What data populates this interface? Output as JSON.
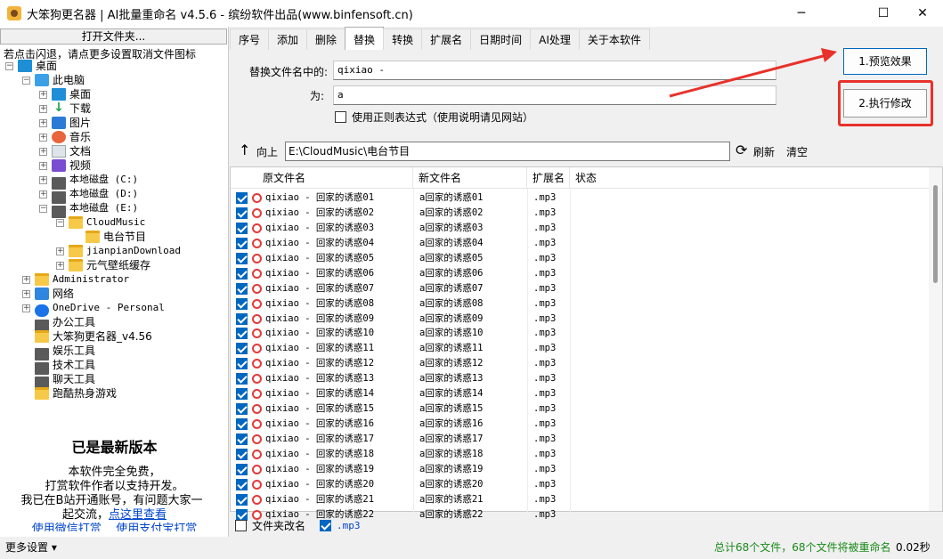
{
  "window": {
    "title": "大笨狗更名器 | AI批量重命名 v4.5.6 - 缤纷软件出品(www.binfensoft.cn)",
    "minimize": "─",
    "maximize": "☐",
    "close": "✕"
  },
  "left": {
    "open_button": "打开文件夹...",
    "hint": "若点击闪退，请点更多设置取消文件图标",
    "tree": [
      {
        "label": "桌面",
        "exp": "−",
        "icon": "desktop-icon",
        "mono": false
      },
      {
        "label": "此电脑",
        "exp": "−",
        "icon": "computer-icon",
        "mono": false
      },
      {
        "label": "桌面",
        "exp": "+",
        "icon": "desktop-icon",
        "mono": false
      },
      {
        "label": "下载",
        "exp": "+",
        "icon": "download-icon",
        "mono": false
      },
      {
        "label": "图片",
        "exp": "+",
        "icon": "pictures-icon",
        "mono": false
      },
      {
        "label": "音乐",
        "exp": "+",
        "icon": "music-icon",
        "mono": false
      },
      {
        "label": "文档",
        "exp": "+",
        "icon": "documents-icon",
        "mono": false
      },
      {
        "label": "视频",
        "exp": "+",
        "icon": "videos-icon",
        "mono": false
      },
      {
        "label": "本地磁盘 (C:)",
        "exp": "+",
        "icon": "drive-icon",
        "mono": true
      },
      {
        "label": "本地磁盘 (D:)",
        "exp": "+",
        "icon": "drive-icon",
        "mono": true
      },
      {
        "label": "本地磁盘 (E:)",
        "exp": "−",
        "icon": "drive-icon",
        "mono": true
      },
      {
        "label": "CloudMusic",
        "exp": "−",
        "icon": "folder-icon",
        "mono": true
      },
      {
        "label": "电台节目",
        "exp": "",
        "icon": "folder-icon",
        "mono": false
      },
      {
        "label": "jianpianDownload",
        "exp": "+",
        "icon": "folder-icon",
        "mono": true
      },
      {
        "label": "元气壁纸缓存",
        "exp": "+",
        "icon": "folder-icon",
        "mono": false
      },
      {
        "label": "Administrator",
        "exp": "+",
        "icon": "folder-icon",
        "mono": true
      },
      {
        "label": "网络",
        "exp": "+",
        "icon": "network-icon",
        "mono": false
      },
      {
        "label": "OneDrive - Personal",
        "exp": "+",
        "icon": "cloud-icon",
        "mono": true
      },
      {
        "label": "办公工具",
        "exp": "",
        "icon": "drive-icon",
        "mono": false
      },
      {
        "label": "大笨狗更名器_v4.56",
        "exp": "",
        "icon": "folder-icon",
        "mono": false
      },
      {
        "label": "娱乐工具",
        "exp": "",
        "icon": "drive-icon",
        "mono": false
      },
      {
        "label": "技术工具",
        "exp": "",
        "icon": "drive-icon",
        "mono": false
      },
      {
        "label": "聊天工具",
        "exp": "",
        "icon": "drive-icon",
        "mono": false
      },
      {
        "label": "跑酷热身游戏",
        "exp": "",
        "icon": "folder-icon",
        "mono": false
      }
    ],
    "version_title": "已是最新版本",
    "free_line1": "本软件完全免费，",
    "free_line2": "打赏软件作者以支持开发。",
    "bili_line": "我已在B站开通账号，有问题大家一",
    "bili_line2a": "起交流，",
    "bili_link": "点这里查看",
    "donate_line": "使用微信打赏    使用支付宝打赏",
    "more_settings": "更多设置 ▾"
  },
  "tabs": [
    "序号",
    "添加",
    "删除",
    "替换",
    "转换",
    "扩展名",
    "日期时间",
    "AI处理",
    "关于本软件"
  ],
  "replace": {
    "find_label": "替换文件名中的:",
    "find_value": "qixiao -",
    "with_label": "为:",
    "with_value": "a",
    "regex_label": "使用正则表达式（使用说明请见网站）"
  },
  "actions": {
    "preview": "1.预览效果",
    "execute": "2.执行修改"
  },
  "pathbar": {
    "up": "向上",
    "path": "E:\\CloudMusic\\电台节目",
    "refresh": "刷新",
    "clear": "清空"
  },
  "columns": [
    "原文件名",
    "新文件名",
    "扩展名",
    "状态"
  ],
  "files": [
    {
      "orig": "qixiao - 回家的诱惑01",
      "new": "a回家的诱惑01",
      "ext": ".mp3"
    },
    {
      "orig": "qixiao - 回家的诱惑02",
      "new": "a回家的诱惑02",
      "ext": ".mp3"
    },
    {
      "orig": "qixiao - 回家的诱惑03",
      "new": "a回家的诱惑03",
      "ext": ".mp3"
    },
    {
      "orig": "qixiao - 回家的诱惑04",
      "new": "a回家的诱惑04",
      "ext": ".mp3"
    },
    {
      "orig": "qixiao - 回家的诱惑05",
      "new": "a回家的诱惑05",
      "ext": ".mp3"
    },
    {
      "orig": "qixiao - 回家的诱惑06",
      "new": "a回家的诱惑06",
      "ext": ".mp3"
    },
    {
      "orig": "qixiao - 回家的诱惑07",
      "new": "a回家的诱惑07",
      "ext": ".mp3"
    },
    {
      "orig": "qixiao - 回家的诱惑08",
      "new": "a回家的诱惑08",
      "ext": ".mp3"
    },
    {
      "orig": "qixiao - 回家的诱惑09",
      "new": "a回家的诱惑09",
      "ext": ".mp3"
    },
    {
      "orig": "qixiao - 回家的诱惑10",
      "new": "a回家的诱惑10",
      "ext": ".mp3"
    },
    {
      "orig": "qixiao - 回家的诱惑11",
      "new": "a回家的诱惑11",
      "ext": ".mp3"
    },
    {
      "orig": "qixiao - 回家的诱惑12",
      "new": "a回家的诱惑12",
      "ext": ".mp3"
    },
    {
      "orig": "qixiao - 回家的诱惑13",
      "new": "a回家的诱惑13",
      "ext": ".mp3"
    },
    {
      "orig": "qixiao - 回家的诱惑14",
      "new": "a回家的诱惑14",
      "ext": ".mp3"
    },
    {
      "orig": "qixiao - 回家的诱惑15",
      "new": "a回家的诱惑15",
      "ext": ".mp3"
    },
    {
      "orig": "qixiao - 回家的诱惑16",
      "new": "a回家的诱惑16",
      "ext": ".mp3"
    },
    {
      "orig": "qixiao - 回家的诱惑17",
      "new": "a回家的诱惑17",
      "ext": ".mp3"
    },
    {
      "orig": "qixiao - 回家的诱惑18",
      "new": "a回家的诱惑18",
      "ext": ".mp3"
    },
    {
      "orig": "qixiao - 回家的诱惑19",
      "new": "a回家的诱惑19",
      "ext": ".mp3"
    },
    {
      "orig": "qixiao - 回家的诱惑20",
      "new": "a回家的诱惑20",
      "ext": ".mp3"
    },
    {
      "orig": "qixiao - 回家的诱惑21",
      "new": "a回家的诱惑21",
      "ext": ".mp3"
    },
    {
      "orig": "qixiao - 回家的诱惑22",
      "new": "a回家的诱惑22",
      "ext": ".mp3"
    }
  ],
  "bottom": {
    "folder_rename": "文件夹改名",
    "ext_filter": ".mp3"
  },
  "status": {
    "summary": "总计68个文件，68个文件将被重命名",
    "time": "0.02秒"
  },
  "colors": {
    "accent": "#0067c0",
    "annotation_red": "#e8312a",
    "status_green": "#1a8a1a"
  }
}
